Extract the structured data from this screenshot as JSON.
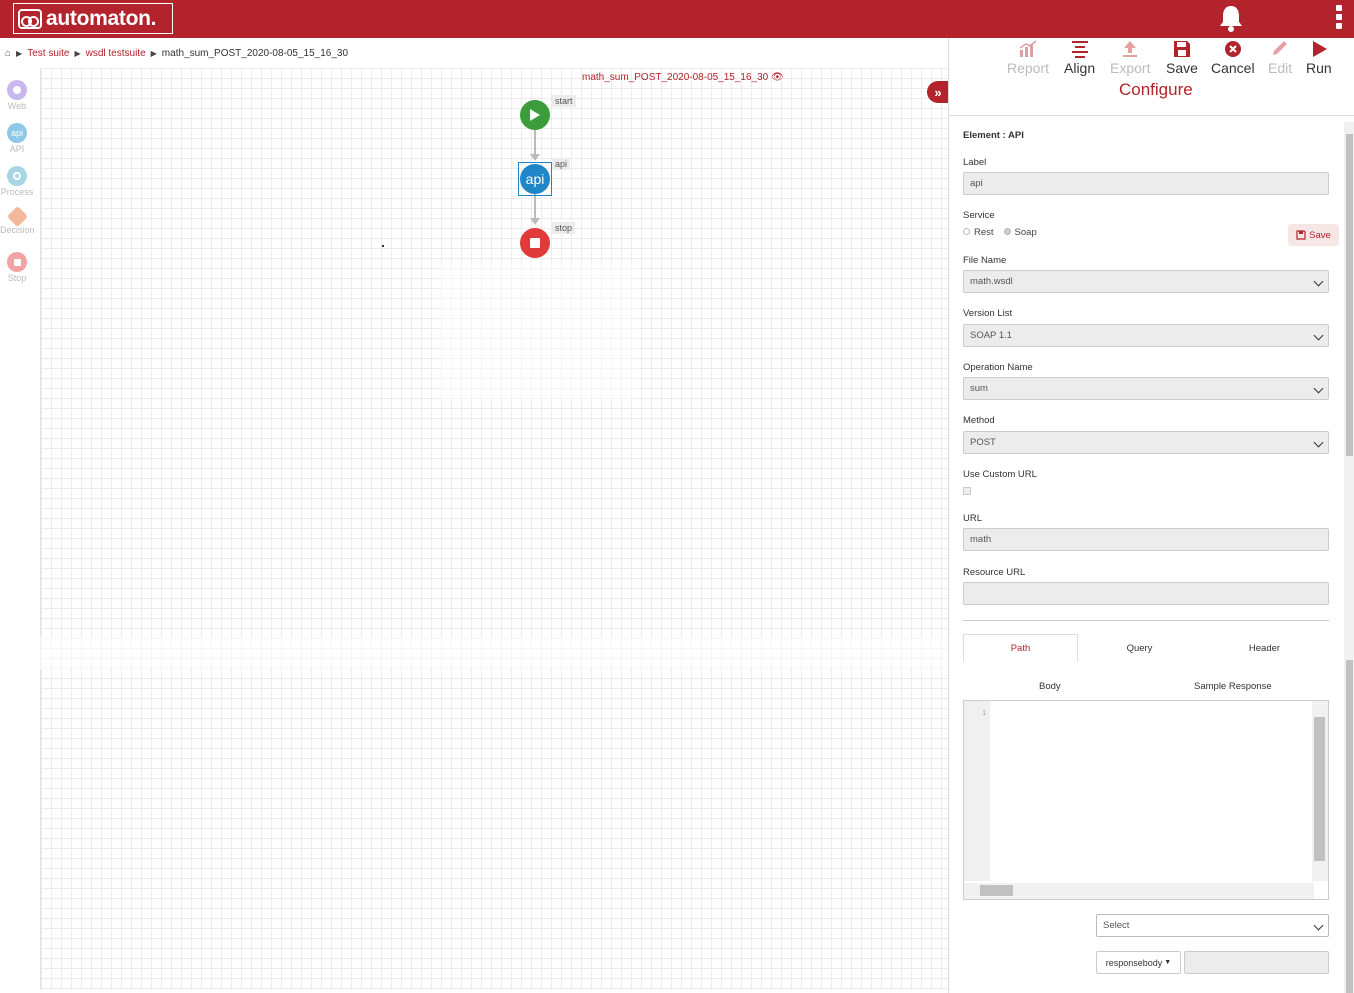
{
  "app": {
    "logo_text": "automaton."
  },
  "breadcrumb": {
    "items": [
      "Test suite",
      "wsdl testsuite",
      "math_sum_POST_2020-08-05_15_16_30"
    ]
  },
  "canvas": {
    "flow_title": "math_sum_POST_2020-08-05_15_16_30"
  },
  "palette": [
    {
      "label": "Web",
      "icon": "web-icon",
      "color": "#c9b8ee"
    },
    {
      "label": "API",
      "icon": "api-icon",
      "color": "#8fc7e8",
      "glyph": "api"
    },
    {
      "label": "Process",
      "icon": "process-icon",
      "color": "#a8d6e6"
    },
    {
      "label": "Decision",
      "icon": "decision-icon",
      "color": "#f4b89a"
    },
    {
      "label": "Stop",
      "icon": "stop-icon",
      "color": "#f3a3a3"
    }
  ],
  "nodes": {
    "start": {
      "label": "start",
      "color": "#3a9c3a"
    },
    "api": {
      "label": "api",
      "glyph": "api",
      "color": "#1f86c8"
    },
    "stop": {
      "label": "stop",
      "color": "#e03a3a"
    }
  },
  "toolbar": {
    "report": "Report",
    "align": "Align",
    "export": "Export",
    "save": "Save",
    "cancel": "Cancel",
    "edit": "Edit",
    "run": "Run",
    "configure": "Configure"
  },
  "form": {
    "element_label": "Element : API",
    "label_label": "Label",
    "label_value": "api",
    "service_label": "Service",
    "service_rest": "Rest",
    "service_soap": "Soap",
    "save_button": "Save",
    "file_name_label": "File Name",
    "file_name_value": "math.wsdl",
    "version_label": "Version List",
    "version_value": "SOAP 1.1",
    "operation_label": "Operation Name",
    "operation_value": "sum",
    "method_label": "Method",
    "method_value": "POST",
    "custom_url_label": "Use Custom URL",
    "url_label": "URL",
    "url_value": "math",
    "resource_url_label": "Resource URL",
    "resource_url_value": "",
    "tabs": [
      "Path",
      "Query",
      "Header"
    ],
    "subtabs": [
      "Body",
      "Sample Response"
    ],
    "editor_line": "1",
    "select_placeholder": "Select",
    "responsebody_label": "responsebody"
  },
  "colors": {
    "brand": "#b3232b"
  }
}
